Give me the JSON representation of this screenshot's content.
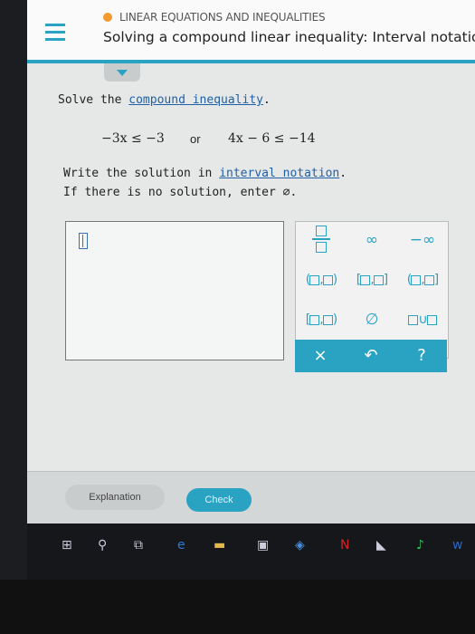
{
  "header": {
    "topic": "LINEAR EQUATIONS AND INEQUALITIES",
    "title": "Solving a compound linear inequality: Interval notatio"
  },
  "question": {
    "prompt_before": "Solve the ",
    "prompt_link": "compound inequality",
    "prompt_after": ".",
    "inequality_left": "−3x ≤ −3",
    "or_word": "or",
    "inequality_right": "4x − 6 ≤ −14",
    "instruction1_before": "Write the solution in ",
    "instruction1_link": "interval notation",
    "instruction1_after": ".",
    "instruction2": "If there is no solution, enter ∅."
  },
  "keypad": {
    "infinity": "∞",
    "neg_infinity": "−∞",
    "empty_set": "∅",
    "union": "∪",
    "clear": "×",
    "undo": "↶",
    "help": "?"
  },
  "footer": {
    "explanation_label": "Explanation",
    "check_label": "Check"
  },
  "taskbar": {
    "items": [
      "windows-icon",
      "search-icon",
      "task-view-icon",
      "edge-icon",
      "file-explorer-icon",
      "store-icon",
      "dropbox-icon",
      "netflix-icon",
      "app-icon",
      "media-icon",
      "word-icon"
    ]
  },
  "colors": {
    "accent": "#2aa3c2",
    "topic_dot": "#f29a2e",
    "link": "#1f5fa6"
  }
}
